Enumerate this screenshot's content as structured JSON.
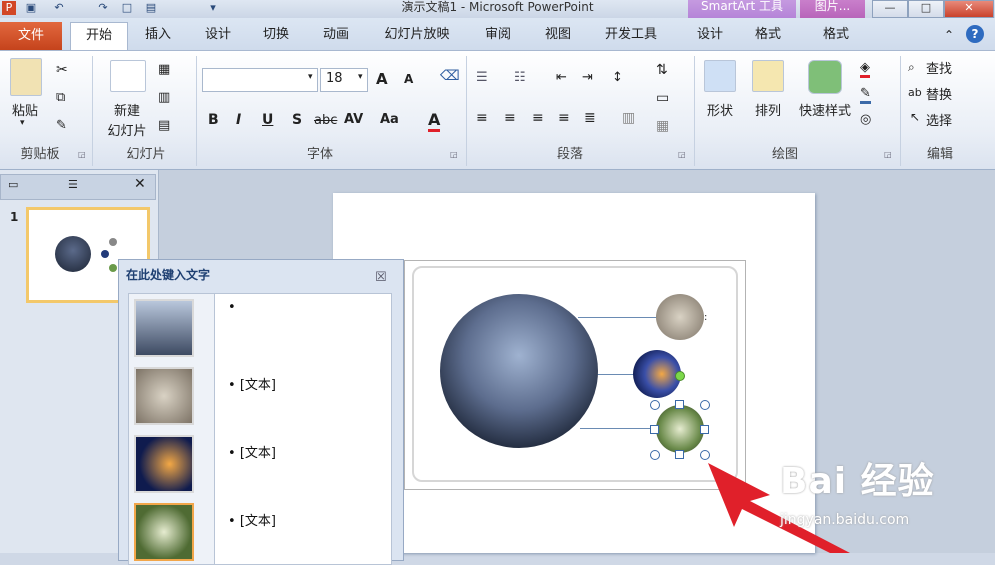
{
  "window": {
    "title": "演示文稿1 - Microsoft PowerPoint",
    "contextual_tabs": {
      "smartart": "SmartArt 工具",
      "picture": "图片..."
    }
  },
  "tabs": [
    "文件",
    "开始",
    "插入",
    "设计",
    "切换",
    "动画",
    "幻灯片放映",
    "审阅",
    "视图",
    "开发工具",
    "设计",
    "格式",
    "格式"
  ],
  "ribbon": {
    "clipboard": {
      "paste": "粘贴",
      "label": "剪贴板"
    },
    "slides": {
      "new_slide_1": "新建",
      "new_slide_2": "幻灯片",
      "label": "幻灯片"
    },
    "font": {
      "size": "18",
      "bold": "B",
      "italic": "I",
      "underline": "U",
      "shadow": "S",
      "strike": "abc",
      "spacing": "AV",
      "case": "Aa",
      "color": "A",
      "grow": "A",
      "shrink": "A",
      "label": "字体"
    },
    "paragraph": {
      "label": "段落"
    },
    "drawing": {
      "shapes": "形状",
      "arrange": "排列",
      "quick_styles": "快速样式",
      "label": "绘图"
    },
    "editing": {
      "find": "查找",
      "replace": "替换",
      "select": "选择",
      "label": "编辑"
    }
  },
  "slides_panel": {
    "slide_number": "1"
  },
  "text_pane": {
    "title": "在此处键入文字",
    "close": "☒",
    "items": [
      "",
      "[文本]",
      "[文本]",
      "[文本]"
    ]
  },
  "watermark": {
    "logo": "Bai 经验",
    "url": "jingyan.baidu.com"
  },
  "colors": {
    "file_tab": "#c5431c",
    "smartart_tab": "#b17fd6",
    "picture_tab": "#b45fb6",
    "arrow": "#e0202a"
  }
}
